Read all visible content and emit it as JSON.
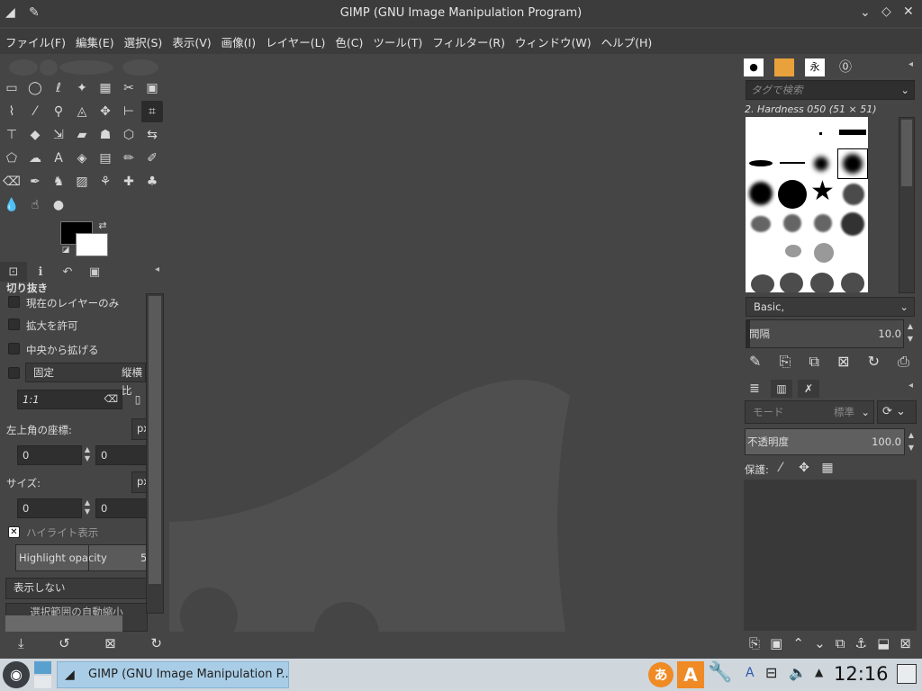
{
  "window": {
    "title": "GIMP (GNU Image Manipulation Program)"
  },
  "menu": [
    "ファイル(F)",
    "編集(E)",
    "選択(S)",
    "表示(V)",
    "画像(I)",
    "レイヤー(L)",
    "色(C)",
    "ツール(T)",
    "フィルター(R)",
    "ウィンドウ(W)",
    "ヘルプ(H)"
  ],
  "tool_options": {
    "title": "切り抜き",
    "current_layer_only": "現在のレイヤーのみ",
    "allow_growing": "拡大を許可",
    "expand_from_center": "中央から拡げる",
    "fixed": "固定",
    "fixed_mode": "縦横比",
    "ratio": "1:1",
    "position_label": "左上角の座標:",
    "position_unit": "px",
    "pos_x": "0",
    "pos_y": "0",
    "size_label": "サイズ:",
    "size_unit": "px",
    "size_w": "0",
    "size_h": "0",
    "highlight": "ハイライト表示",
    "highlight_opacity_label": "Highlight opacity",
    "highlight_opacity_value": "5",
    "guides": "表示しない",
    "auto_shrink": "選択範囲の自動縮小"
  },
  "brushes": {
    "search_placeholder": "タグで検索",
    "selected_brush": "2. Hardness 050 (51 × 51)",
    "tag": "Basic,",
    "spacing_label": "間隔",
    "spacing_value": "10.0"
  },
  "layers": {
    "mode_label": "モード",
    "mode_value": "標準",
    "opacity_label": "不透明度",
    "opacity_value": "100.0",
    "lock_label": "保護:"
  },
  "taskbar": {
    "task_label": "GIMP (GNU Image Manipulation P...",
    "clock": "12:16",
    "ime_a": "あ",
    "ime_A": "A",
    "tray_a": "A"
  },
  "colors": {
    "foreground": "#000000",
    "background": "#ffffff",
    "accent": "#a9cde6"
  }
}
